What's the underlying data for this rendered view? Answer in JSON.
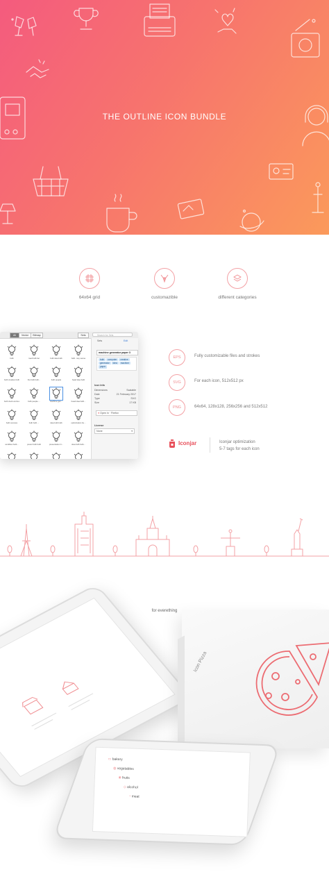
{
  "hero": {
    "title": "THE OUTLINE ICON BUNDLE",
    "gradient": [
      "#f45b7e",
      "#fb9a5b"
    ]
  },
  "features": [
    {
      "label": "64x64 grid",
      "icon": "grid-icon"
    },
    {
      "label": "customazible",
      "icon": "customize-icon"
    },
    {
      "label": "different categories",
      "icon": "layers-icon"
    }
  ],
  "app": {
    "tabs": [
      "All",
      "Vector",
      "Bitmap"
    ],
    "size_label": "Sets",
    "search_placeholder": "Search for Sets",
    "side_tabs": [
      "Sets",
      "Edit"
    ],
    "icon_name": "machine generator paper 3",
    "tags": [
      "bulb",
      "computer",
      "creative",
      "generator",
      "idea",
      "machine",
      "paper"
    ],
    "info_title": "Icon Info",
    "info": [
      {
        "k": "Dimensions",
        "v": "Scalable"
      },
      {
        "k": "Date",
        "v": "21 February 2017"
      },
      {
        "k": "Type",
        "v": "SVG"
      },
      {
        "k": "Size",
        "v": "17 KB"
      }
    ],
    "open_label": "Open in · Firefox",
    "license_title": "License",
    "license_value": "None",
    "icons": [
      "bulb",
      "road bulb fac",
      "bulb idea bulb",
      "bulb - key sense",
      "bulb creative bulb",
      "fire bulb bulb...",
      "bulb people",
      "head idea bulb",
      "bulb clock worried",
      "bulb people ...",
      "machine gen...",
      "head idea bulb...",
      "bulb success",
      "bulb bulb ...",
      "idea bulb bulb",
      "optimization bu...",
      "workflow bulb...",
      "power bulb bulb",
      "presentation b...",
      "idea bulb bulb...",
      "cigarette bulb",
      "plant bulb",
      "power bulb",
      "target bulb ..."
    ]
  },
  "formats": [
    {
      "badge": "EPS",
      "text": "Fully customizable files and strokes"
    },
    {
      "badge": "SVG",
      "text": "For each icon, 512x512 px"
    },
    {
      "badge": "PNG",
      "text": "64x64, 128x128, 256x256 and 512x512"
    }
  ],
  "iconjar": {
    "brand": "Iconjar",
    "line1": "Iconjar optimization",
    "line2": "5-7 tags for each icon"
  },
  "tagline": "for everething",
  "devices": {
    "box_label": "Icon Pizza",
    "phone_items": [
      "bakery",
      "vegetables",
      "fruits",
      "alcohol",
      "meat"
    ]
  },
  "colors": {
    "accent": "#f08c90",
    "brand": "#e8505b"
  }
}
